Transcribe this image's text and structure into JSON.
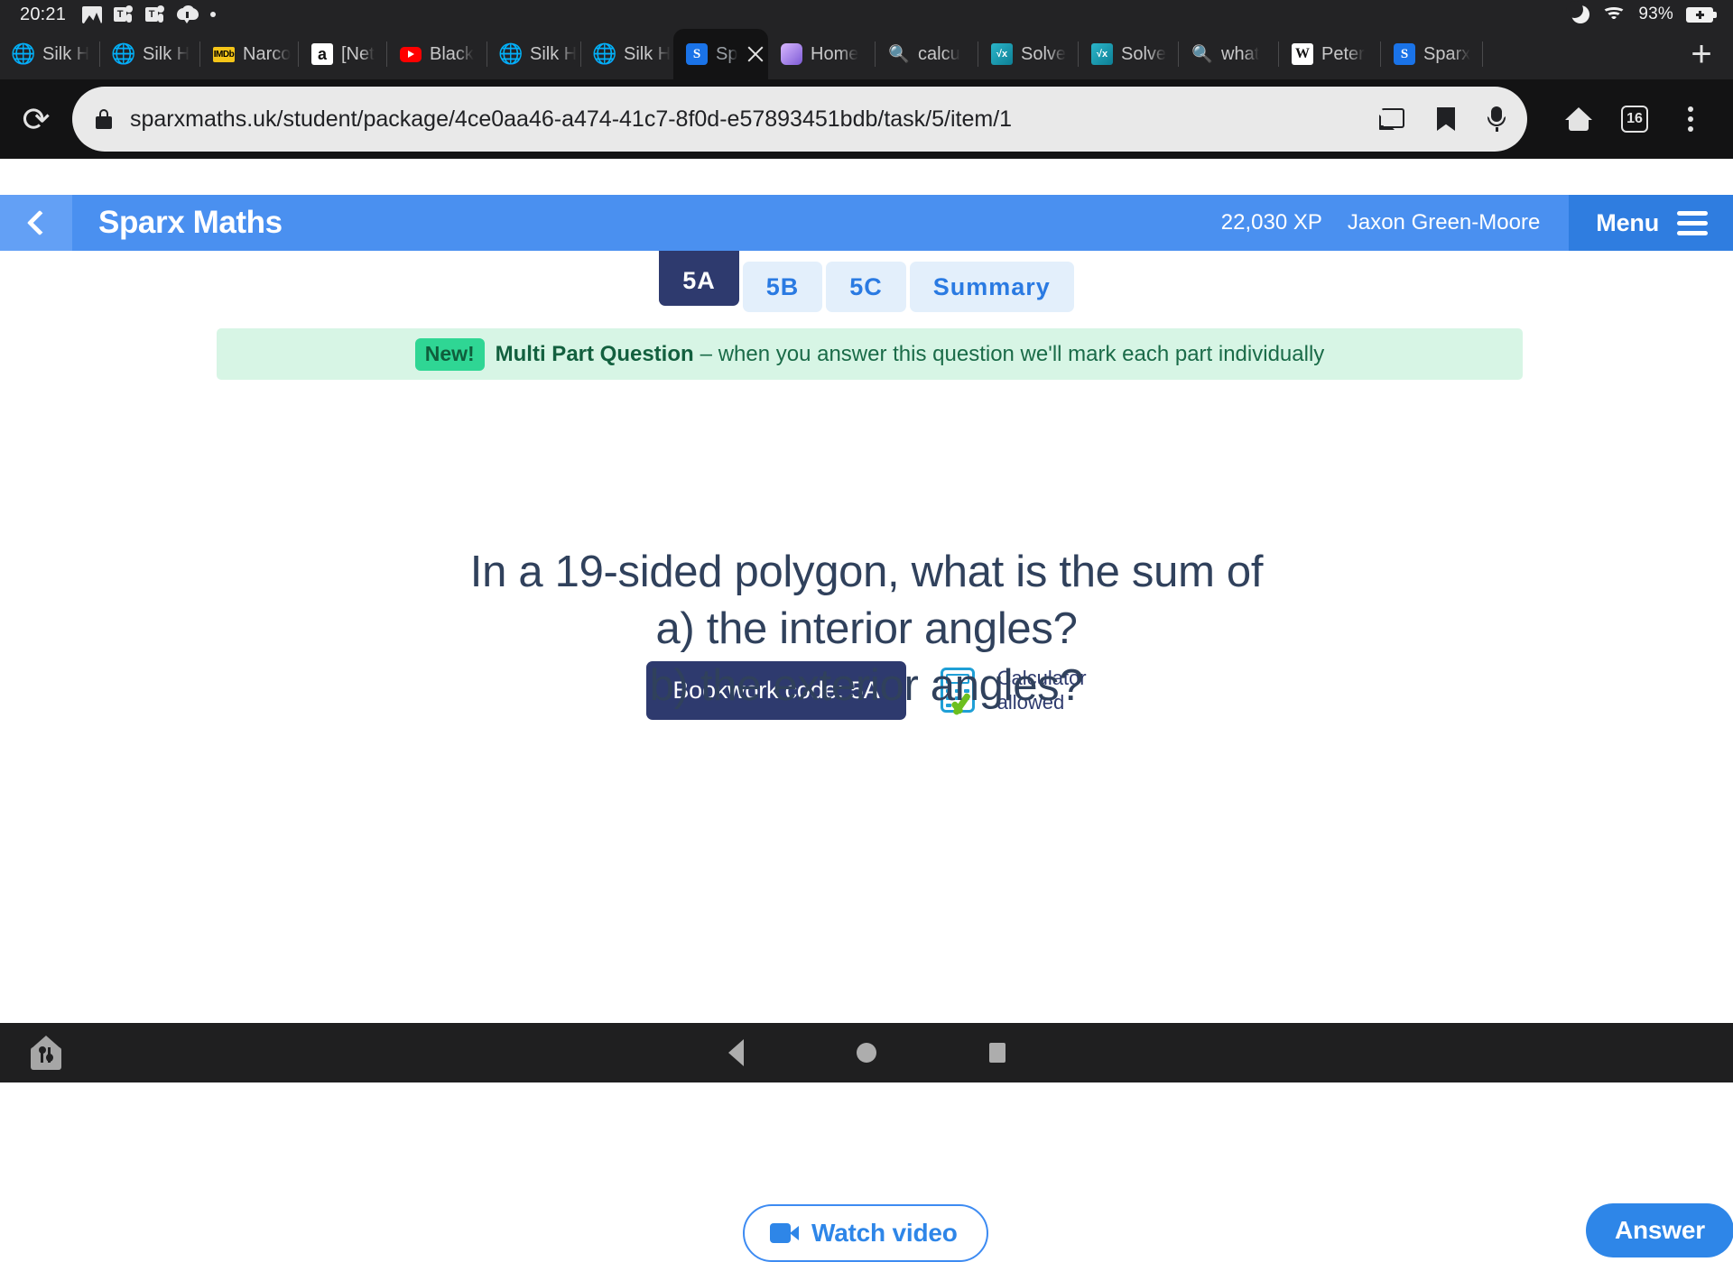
{
  "status_bar": {
    "clock": "20:21",
    "battery_percent": "93%",
    "left_icons": [
      "image-icon",
      "teams-icon",
      "teams-icon",
      "cloud-download-icon",
      "dot-icon"
    ],
    "right_icons": [
      "moon-icon",
      "wifi-icon",
      "battery-charging-icon"
    ]
  },
  "browser": {
    "tabs": [
      {
        "label": "Silk H",
        "favicon": "globe-icon",
        "active": false
      },
      {
        "label": "Silk H",
        "favicon": "globe-icon",
        "active": false
      },
      {
        "label": "Narco",
        "favicon": "imdb-icon",
        "active": false
      },
      {
        "label": "[Net",
        "favicon": "amazon-icon",
        "active": false
      },
      {
        "label": "Black",
        "favicon": "youtube-icon",
        "active": false
      },
      {
        "label": "Silk H",
        "favicon": "globe-icon",
        "active": false
      },
      {
        "label": "Silk H",
        "favicon": "globe-icon",
        "active": false
      },
      {
        "label": "Sp",
        "favicon": "sparx-icon",
        "active": true
      },
      {
        "label": "Home",
        "favicon": "home3d-icon",
        "active": false
      },
      {
        "label": "calcu",
        "favicon": "search-icon",
        "active": false
      },
      {
        "label": "Solve",
        "favicon": "mathsolver-icon",
        "active": false
      },
      {
        "label": "Solve",
        "favicon": "mathsolver-icon",
        "active": false
      },
      {
        "label": "what",
        "favicon": "search-icon",
        "active": false
      },
      {
        "label": "Peter",
        "favicon": "wikipedia-icon",
        "active": false
      },
      {
        "label": "Sparx",
        "favicon": "sparx-icon",
        "active": false
      }
    ],
    "new_tab_label": "+",
    "reload_label": "⟳",
    "url": "sparxmaths.uk/student/package/4ce0aa46-a474-41c7-8f0d-e57893451bdb/task/5/item/1",
    "tab_count": "16",
    "omnibox_icons": [
      "cast-icon",
      "bookmark-icon",
      "microphone-icon"
    ],
    "toolbar_icons": [
      "home-icon",
      "tab-count-icon",
      "overflow-menu-icon"
    ]
  },
  "app_header": {
    "title": "Sparx Maths",
    "xp": "22,030 XP",
    "user": "Jaxon Green-Moore",
    "menu_label": "Menu",
    "back_icon": "chevron-left-icon",
    "brand_color": "#4a90f0",
    "menu_panel_color": "#2f7de0"
  },
  "question_tabs": [
    {
      "label": "5A",
      "active": true
    },
    {
      "label": "5B",
      "active": false
    },
    {
      "label": "5C",
      "active": false
    },
    {
      "label": "Summary",
      "active": false
    }
  ],
  "banner": {
    "badge": "New!",
    "strong": "Multi Part Question",
    "text": "– when you answer this question we'll mark each part individually",
    "background_color": "#d7f5e5",
    "badge_color": "#2fd694"
  },
  "meta": {
    "bookwork_code": "Bookwork code: 5A",
    "calculator_line1": "Calculator",
    "calculator_line2": "allowed",
    "calculator_icon": "calculator-allowed-icon",
    "pill_color": "#2e3a6e"
  },
  "question": {
    "line1": "In a 19-sided polygon, what is the sum of",
    "line2": "a) the interior angles?",
    "line3": "b) the exterior angles?",
    "text_color": "#30415c"
  },
  "footer": {
    "watch_video_label": "Watch video",
    "watch_video_icon": "video-camera-icon",
    "answer_label": "Answer",
    "accent_color": "#2e86e8"
  },
  "nav_bar": {
    "launcher_icon": "house-utensils-icon",
    "back_icon": "triangle-back-icon",
    "home_icon": "circle-home-icon",
    "recents_icon": "square-recents-icon"
  }
}
